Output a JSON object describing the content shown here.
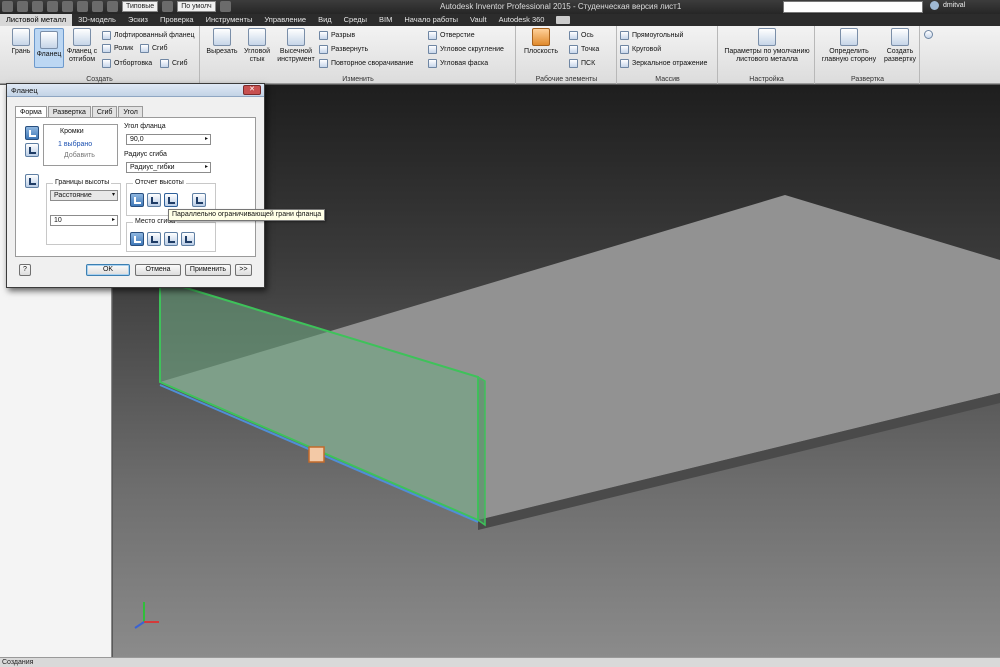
{
  "titlebar": {
    "title": "Autodesk Inventor Professional 2015 - Студенческая версия   лист1",
    "style_dropdown": "Типовые",
    "view_dropdown": "По умолч",
    "user": "dmitval"
  },
  "menu": {
    "tabs": [
      "Листовой металл",
      "3D-модель",
      "Эскиз",
      "Проверка",
      "Инструменты",
      "Управление",
      "Вид",
      "Среды",
      "BIM",
      "Начало работы",
      "Vault",
      "Autodesk 360"
    ],
    "active_index": 0
  },
  "ribbon": {
    "create": {
      "label": "Создать",
      "face": "Грань",
      "flange": "Фланец",
      "contour_flange": "Фланец с отгибом",
      "lofted_flange": "Лофтированный фланец",
      "roll": "Ролик",
      "hem": "Отбортовка",
      "bend": "Сгиб",
      "fold": "Сгиб"
    },
    "modify": {
      "label": "Изменить",
      "cut": "Вырезать",
      "corner_seam": "Угловой стык",
      "punch": "Высечной инструмент",
      "rip": "Разрыв",
      "unfold": "Развернуть",
      "refold": "Повторное сворачивание",
      "hole": "Отверстие",
      "corner_round": "Угловое скругление",
      "corner_chamfer": "Угловая фаска"
    },
    "work": {
      "label": "Рабочие элементы",
      "plane": "Плоскость",
      "axis": "Ось",
      "point": "Точка",
      "ucs": "ПСК"
    },
    "pattern": {
      "label": "Массив",
      "rect": "Прямоугольный",
      "circ": "Круговой",
      "mirror": "Зеркальное отражение"
    },
    "setup": {
      "label": "Настройка",
      "defaults": "Параметры по умолчанию листового металла"
    },
    "flat": {
      "label": "Развертка",
      "define_a_side": "Определить главную сторону",
      "create_flat": "Создать развертку"
    }
  },
  "dialog": {
    "title": "Фланец",
    "tabs": [
      "Форма",
      "Развертка",
      "Сгиб",
      "Угол"
    ],
    "edges_label": "Кромки",
    "edges_selected": "1 выбрано",
    "edges_add": "Добавить",
    "flange_angle_label": "Угол фланца",
    "flange_angle_value": "90,0",
    "bend_radius_label": "Радиус сгиба",
    "bend_radius_value": "Радиус_гибки",
    "height_extents_label": "Границы высоты",
    "height_extents_value": "Расстояние",
    "height_value": "10",
    "height_datum_label": "Отсчет высоты",
    "bend_position_label": "Место сгиба",
    "ok": "OK",
    "cancel": "Отмена",
    "apply": "Применить",
    "more": ">>",
    "help": "?"
  },
  "tooltip": "Параллельно ограничивающей грани фланца",
  "status": "Создания"
}
